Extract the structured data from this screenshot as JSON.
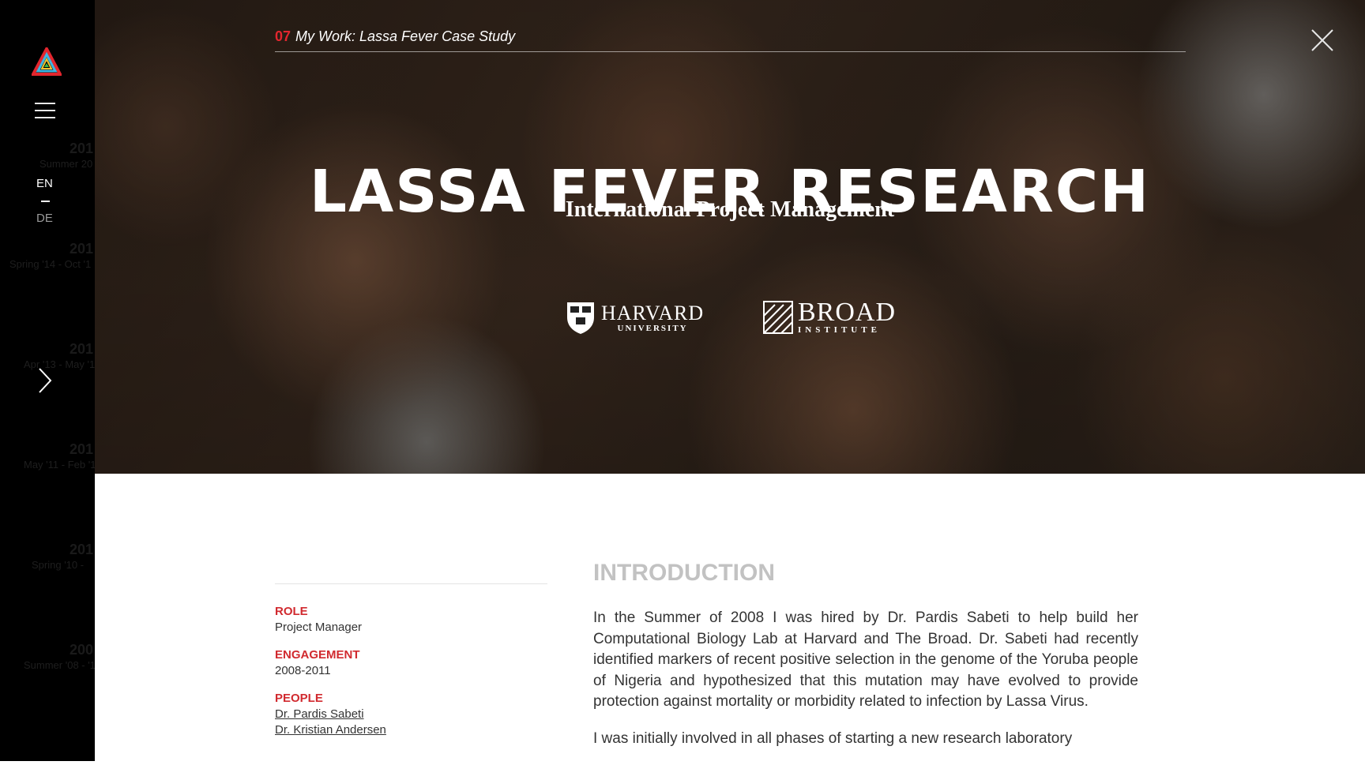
{
  "sidebar": {
    "lang_en": "EN",
    "lang_de": "DE",
    "icons": {
      "logo": "triangle-logo-icon",
      "menu": "hamburger-menu-icon",
      "next": "chevron-right-icon"
    }
  },
  "header": {
    "section_number": "07",
    "breadcrumb": "My Work: Lassa Fever Case Study",
    "close_icon": "close-x-icon"
  },
  "hero": {
    "title": "LASSA FEVER RESEARCH",
    "subtitle": "International Project Management",
    "logos": {
      "harvard_name": "HARVARD",
      "harvard_sub": "UNIVERSITY",
      "broad_name": "BROAD",
      "broad_sub": "INSTITUTE"
    }
  },
  "content": {
    "intro_heading": "INTRODUCTION",
    "meta": {
      "role_label": "ROLE",
      "role_value": "Project Manager",
      "engagement_label": "ENGAGEMENT",
      "engagement_value": "2008-2011",
      "people_label": "PEOPLE",
      "people": [
        "Dr. Pardis Sabeti",
        "Dr. Kristian Andersen"
      ]
    },
    "paragraphs": [
      "In the Summer of 2008 I was hired by Dr. Pardis Sabeti to help build her Computational Biology Lab at Harvard and The Broad. Dr. Sabeti had recently identified markers of recent positive selection in the genome of the Yoruba people of Nigeria and hypothesized that this mutation may have evolved to provide protection against mortality or morbidity related to infection by Lassa Virus.",
      "I was initially involved in all phases of starting a new research laboratory"
    ]
  },
  "colors": {
    "accent_red": "#d12a2f",
    "sidebar_bg": "#000000",
    "heading_gray": "#c2c2c2"
  }
}
